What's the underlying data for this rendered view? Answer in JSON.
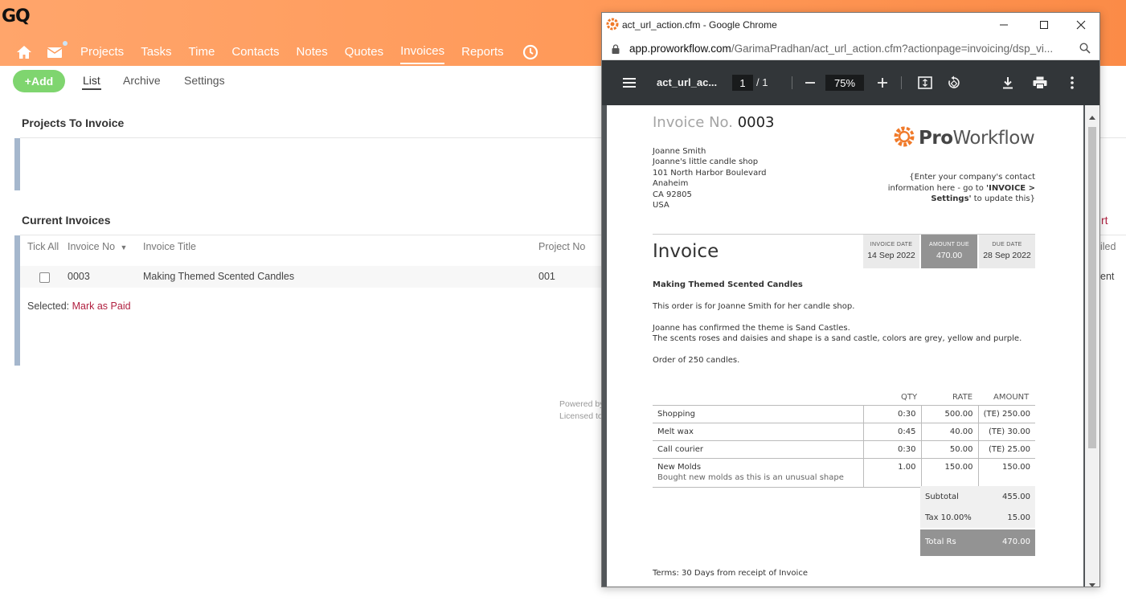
{
  "app": {
    "logo": "GQ",
    "nav": [
      "Projects",
      "Tasks",
      "Time",
      "Contacts",
      "Notes",
      "Quotes",
      "Invoices",
      "Reports"
    ],
    "active_nav": "Invoices",
    "add_label": "+Add",
    "subtabs": [
      "List",
      "Archive",
      "Settings"
    ],
    "projects_to_invoice_title": "Projects To Invoice",
    "current_invoices_title": "Current Invoices",
    "columns": [
      "Tick All",
      "Invoice No",
      "Invoice Title",
      "Project No"
    ],
    "row": {
      "invoice_no": "0003",
      "title": "Making Themed Scented Candles",
      "project_no": "001"
    },
    "selected_label": "Selected:",
    "mark_as_paid": "Mark as Paid",
    "footer_1": "Powered by",
    "footer_2": "Licensed to",
    "partial_right_1": "rt",
    "partial_right_2": "iled",
    "partial_right_3": "ent",
    "accent_color": "#b01f3f"
  },
  "chrome": {
    "title": "act_url_action.cfm - Google Chrome",
    "url_domain": "app.proworkflow.com",
    "url_path": "/GarimaPradhan/act_url_action.cfm?actionpage=invoicing/dsp_vi...",
    "pdf_name": "act_url_ac...",
    "page_current": "1",
    "page_total": "/ 1",
    "zoom": "75%"
  },
  "invoice": {
    "number_label": "Invoice No.",
    "number": "0003",
    "address": [
      "Joanne Smith",
      "Joanne's little candle shop",
      "101 North Harbor Boulevard",
      "Anaheim",
      "CA 92805",
      "USA"
    ],
    "logo_text_bold": "Pro",
    "logo_text": "Workflow",
    "contact_1": "{Enter your company's contact",
    "contact_2a": "information here - go to ",
    "contact_2b": "'INVOICE >",
    "contact_3a": "Settings'",
    "contact_3b": " to update this}",
    "heading": "Invoice",
    "invoice_date_label": "INVOICE DATE",
    "invoice_date": "14 Sep 2022",
    "amount_due_label": "AMOUNT DUE",
    "amount_due": "470.00",
    "due_date_label": "DUE DATE",
    "due_date": "28 Sep 2022",
    "title": "Making Themed Scented Candles",
    "desc_1": "This order is for Joanne Smith for her candle shop.",
    "desc_2": "Joanne has confirmed the theme is Sand Castles.",
    "desc_3": "The scents roses and daisies and shape is a sand castle, colors are grey, yellow and purple.",
    "desc_4": "Order of 250 candles.",
    "col_qty": "QTY",
    "col_rate": "RATE",
    "col_amount": "AMOUNT",
    "items": [
      {
        "name": "Shopping",
        "desc": "",
        "qty": "0:30",
        "rate": "500.00",
        "amount": "(TE) 250.00"
      },
      {
        "name": "Melt wax",
        "desc": "",
        "qty": "0:45",
        "rate": "40.00",
        "amount": "(TE) 30.00"
      },
      {
        "name": "Call courier",
        "desc": "",
        "qty": "0:30",
        "rate": "50.00",
        "amount": "(TE) 25.00"
      },
      {
        "name": "New Molds",
        "desc": "Bought new molds as this is an unusual shape",
        "qty": "1.00",
        "rate": "150.00",
        "amount": "150.00"
      }
    ],
    "subtotal_label": "Subtotal",
    "subtotal": "455.00",
    "tax_label": "Tax 10.00%",
    "tax": "15.00",
    "total_label": "Total Rs",
    "total": "470.00",
    "terms": "Terms: 30 Days from receipt of Invoice"
  }
}
